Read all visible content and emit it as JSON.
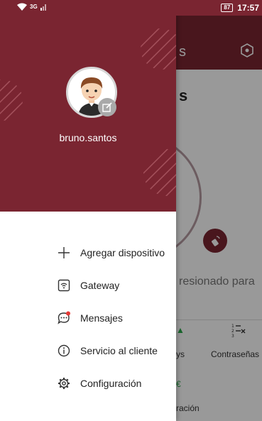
{
  "status_bar": {
    "network": "3G",
    "battery": "87",
    "time": "17:57"
  },
  "background_app": {
    "header_title_fragment": "s",
    "heading_fragment": "s",
    "hint_fragment": "resionado para",
    "tab_1_fragment": "ys",
    "tab_2_label": "Contraseñas",
    "bottom_fragment": "ración"
  },
  "drawer": {
    "username": "bruno.santos",
    "menu_items": [
      {
        "label": "Agregar dispositivo",
        "icon": "plus-icon"
      },
      {
        "label": "Gateway",
        "icon": "gateway-icon"
      },
      {
        "label": "Mensajes",
        "icon": "message-icon",
        "badge_color": "#e53935"
      },
      {
        "label": "Servicio al cliente",
        "icon": "info-icon"
      },
      {
        "label": "Configuración",
        "icon": "gear-icon"
      }
    ]
  },
  "colors": {
    "brand": "#7a2531",
    "accent_green": "#2aa84a",
    "notification_dot": "#e53935"
  }
}
